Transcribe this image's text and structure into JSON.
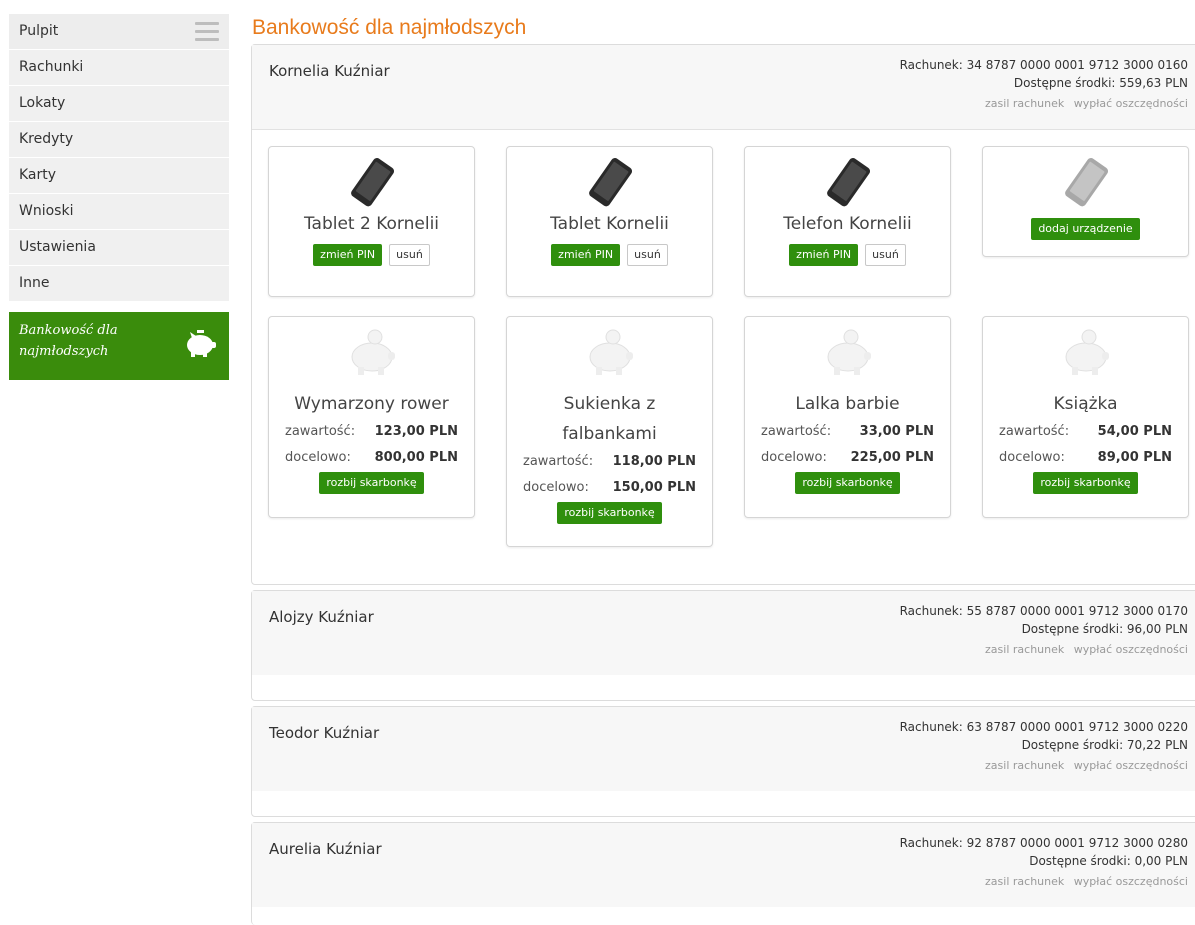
{
  "sidebar": {
    "items": [
      "Pulpit",
      "Rachunki",
      "Lokaty",
      "Kredyty",
      "Karty",
      "Wnioski",
      "Ustawienia",
      "Inne"
    ],
    "kids_box": {
      "line1": "Bankowość dla",
      "line2": "najmłodszych"
    }
  },
  "page": {
    "title": "Bankowość dla najmłodszych"
  },
  "accounts": [
    {
      "name": "Kornelia Kuźniar",
      "account_line": "Rachunek: 34 8787 0000 0001 9712 3000 0160",
      "balance_line": "Dostępne środki: 559,63 PLN",
      "link_topup": "zasil rachunek",
      "link_withdraw": "wypłać oszczędności",
      "devices": [
        {
          "name": "Tablet 2 Kornelii",
          "btn_pin": "zmień PIN",
          "btn_remove": "usuń"
        },
        {
          "name": "Tablet Kornelii",
          "btn_pin": "zmień PIN",
          "btn_remove": "usuń"
        },
        {
          "name": "Telefon Kornelii",
          "btn_pin": "zmień PIN",
          "btn_remove": "usuń"
        }
      ],
      "add_device": "dodaj urządzenie",
      "piggybanks": [
        {
          "name_line1": "Wymarzony rower",
          "name_line2": "",
          "content_label": "zawartość:",
          "content": "123,00 PLN",
          "target_label": "docelowo:",
          "target": "800,00 PLN",
          "btn": "rozbij skarbonkę"
        },
        {
          "name_line1": "Sukienka z",
          "name_line2": "falbankami",
          "content_label": "zawartość:",
          "content": "118,00 PLN",
          "target_label": "docelowo:",
          "target": "150,00 PLN",
          "btn": "rozbij skarbonkę"
        },
        {
          "name_line1": "Lalka barbie",
          "name_line2": "",
          "content_label": "zawartość:",
          "content": "33,00 PLN",
          "target_label": "docelowo:",
          "target": "225,00 PLN",
          "btn": "rozbij skarbonkę"
        },
        {
          "name_line1": "Książka",
          "name_line2": "",
          "content_label": "zawartość:",
          "content": "54,00 PLN",
          "target_label": "docelowo:",
          "target": "89,00 PLN",
          "btn": "rozbij skarbonkę"
        }
      ]
    },
    {
      "name": "Alojzy Kuźniar",
      "account_line": "Rachunek: 55 8787 0000 0001 9712 3000 0170",
      "balance_line": "Dostępne środki: 96,00 PLN",
      "link_topup": "zasil rachunek",
      "link_withdraw": "wypłać oszczędności"
    },
    {
      "name": "Teodor Kuźniar",
      "account_line": "Rachunek: 63 8787 0000 0001 9712 3000 0220",
      "balance_line": "Dostępne środki: 70,22 PLN",
      "link_topup": "zasil rachunek",
      "link_withdraw": "wypłać oszczędności"
    },
    {
      "name": "Aurelia Kuźniar",
      "account_line": "Rachunek: 92 8787 0000 0001 9712 3000 0280",
      "balance_line": "Dostępne środki: 0,00 PLN",
      "link_topup": "zasil rachunek",
      "link_withdraw": "wypłać oszczędności"
    }
  ],
  "colors": {
    "accent_orange": "#e87b1c",
    "brand_green": "#3a8c0c",
    "button_green": "#2f8f0d"
  },
  "icons": {
    "menu": "hamburger-icon",
    "piggy": "piggy-bank-icon",
    "device": "smartphone-icon"
  }
}
